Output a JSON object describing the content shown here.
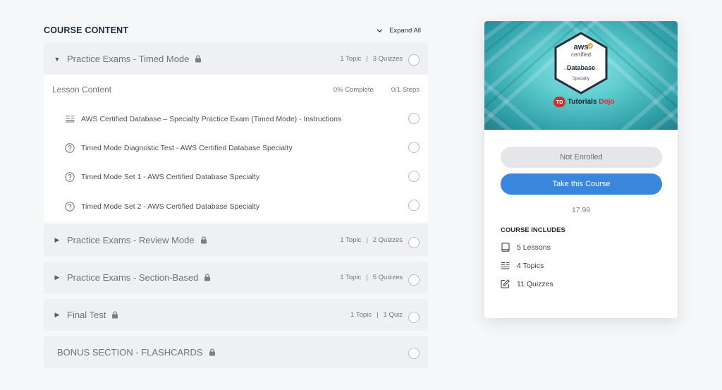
{
  "course_content": {
    "title": "COURSE CONTENT",
    "expand_all": "Expand All",
    "sections": [
      {
        "title": "Practice Exams - Timed Mode",
        "topics": "1 Topic",
        "quizzes": "3 Quizzes",
        "expanded": true
      },
      {
        "title": "Practice Exams - Review Mode",
        "topics": "1 Topic",
        "quizzes": "2 Quizzes",
        "expanded": false
      },
      {
        "title": "Practice Exams - Section-Based",
        "topics": "1 Topic",
        "quizzes": "5 Quizzes",
        "expanded": false
      },
      {
        "title": "Final Test",
        "topics": "1 Topic",
        "quizzes": "1 Quiz",
        "expanded": false
      },
      {
        "title": "BONUS SECTION - FLASHCARDS",
        "topics": "",
        "quizzes": "",
        "expanded": false
      }
    ],
    "lesson_content": {
      "label": "Lesson Content",
      "percent_complete": "0% Complete",
      "steps": "0/1 Steps",
      "items": [
        {
          "icon": "document-lines-icon",
          "text": "AWS Certified Database – Specialty Practice Exam (Timed Mode) - Instructions"
        },
        {
          "icon": "question-circle-icon",
          "text": "Timed Mode Diagnostic Test - AWS Certified Database Specialty"
        },
        {
          "icon": "question-circle-icon",
          "text": "Timed Mode Set 1 - AWS Certified Database Specialty"
        },
        {
          "icon": "question-circle-icon",
          "text": "Timed Mode Set 2 - AWS Certified Database Specialty"
        }
      ]
    },
    "separator": "|"
  },
  "card": {
    "badge": {
      "brand": "aws",
      "certified": "certified",
      "name": "Database",
      "level": "Specialty"
    },
    "logo": {
      "mark": "TD",
      "text1": "Tutorials",
      "text2": "Dojo"
    },
    "not_enrolled": "Not Enrolled",
    "take_course": "Take this Course",
    "price": "17.99",
    "includes_title": "COURSE INCLUDES",
    "includes": [
      {
        "icon": "book-icon",
        "text": "5 Lessons"
      },
      {
        "icon": "topics-list-icon",
        "text": "4 Topics"
      },
      {
        "icon": "quiz-edit-icon",
        "text": "11 Quizzes"
      }
    ]
  },
  "colors": {
    "accent": "#3a86dd",
    "brand_red": "#d42b2b",
    "teal": "#5ccbcd"
  }
}
